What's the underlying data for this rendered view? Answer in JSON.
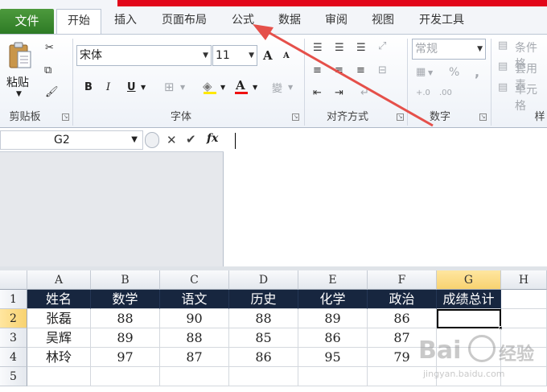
{
  "tabs": {
    "file": "文件",
    "home": "开始",
    "insert": "插入",
    "layout": "页面布局",
    "formulas": "公式",
    "data": "数据",
    "review": "审阅",
    "view": "视图",
    "developer": "开发工具"
  },
  "clipboard": {
    "paste": "粘贴",
    "label": "剪贴板"
  },
  "font": {
    "name": "宋体",
    "size": "11",
    "bold": "B",
    "italic": "I",
    "underline": "U",
    "grow": "A",
    "shrink": "A",
    "font_color": "A",
    "label": "字体"
  },
  "align": {
    "label": "对齐方式"
  },
  "number": {
    "format": "常规",
    "percent": "%",
    "comma": ",",
    "label": "数字"
  },
  "styles": {
    "conditional": "条件格",
    "table": "套用表",
    "cell": "单元格",
    "label": "样"
  },
  "formula_bar": {
    "name_box": "G2",
    "fx": "fx",
    "cancel": "✕",
    "enter": "✔"
  },
  "sheet": {
    "columns": [
      "A",
      "B",
      "C",
      "D",
      "E",
      "F",
      "G",
      "H"
    ],
    "rows": [
      "1",
      "2",
      "3",
      "4",
      "5"
    ],
    "header_row": [
      "姓名",
      "数学",
      "语文",
      "历史",
      "化学",
      "政治",
      "成绩总计"
    ],
    "data_rows": [
      [
        "张磊",
        "88",
        "90",
        "88",
        "89",
        "86",
        ""
      ],
      [
        "吴辉",
        "89",
        "88",
        "85",
        "86",
        "87",
        ""
      ],
      [
        "林玲",
        "97",
        "87",
        "86",
        "95",
        "79",
        ""
      ]
    ],
    "active_cell": "G2"
  },
  "watermark": {
    "brand": "Bai",
    "brand2": "经验",
    "url": "jingyan.baidu.com"
  },
  "colors": {
    "header_fill": "#17263f",
    "file_tab": "#3a8a2f",
    "arrow": "#e5504a",
    "top_strip": "#e2061a"
  }
}
